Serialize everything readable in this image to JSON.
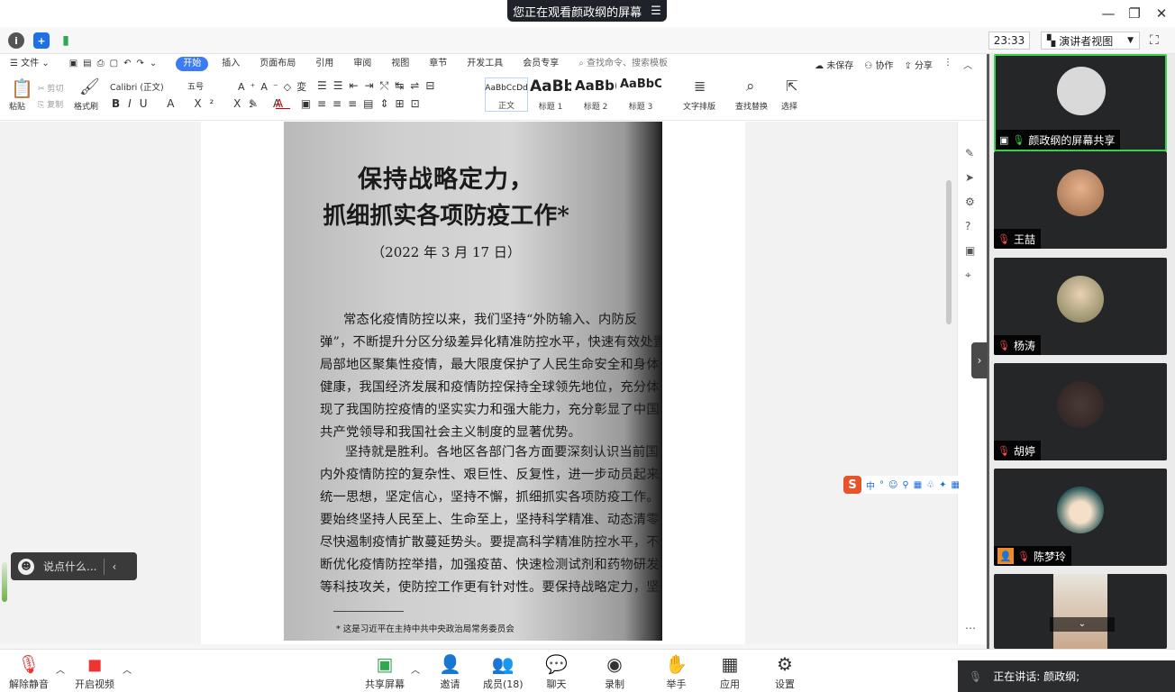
{
  "window": {
    "share_banner": "您正在观看颜政纲的屏幕",
    "min_icon": "—",
    "restore_icon": "❐",
    "close_icon": "✕"
  },
  "meeting_bar": {
    "clock": "23:33",
    "view_mode": "演讲者视图"
  },
  "wps": {
    "file_menu": "文件",
    "tabs": [
      "开始",
      "插入",
      "页面布局",
      "引用",
      "审阅",
      "视图",
      "章节",
      "开发工具",
      "会员专享"
    ],
    "search_placeholder": "查找命令、搜索模板",
    "right_actions": [
      "未保存",
      "协作",
      "分享"
    ],
    "clipboard": {
      "paste": "粘贴",
      "cut": "剪切",
      "copy": "复制",
      "format_painter": "格式刷"
    },
    "font_name": "Calibri (正文)",
    "font_size": "五号",
    "styles": [
      {
        "sample": "AaBbCcDd",
        "name": "正文"
      },
      {
        "sample": "AaBb",
        "name": "标题 1"
      },
      {
        "sample": "AaBb(",
        "name": "标题 2"
      },
      {
        "sample": "AaBbC",
        "name": "标题 3"
      }
    ],
    "text_layout": "文字排版",
    "find_replace": "查找替换",
    "select": "选择"
  },
  "document": {
    "title_line1": "保持战略定力，",
    "title_line2": "抓细抓实各项防疫工作*",
    "date": "（2022 年 3 月 17 日）",
    "lines": [
      "常态化疫情防控以来，我们坚持“外防输入、内防反",
      "弹”，不断提升分区分级差异化精准防控水平，快速有效处置",
      "局部地区聚集性疫情，最大限度保护了人民生命安全和身体",
      "健康，我国经济发展和疫情防控保持全球领先地位，充分体",
      "现了我国防控疫情的坚实实力和强大能力，充分彰显了中国",
      "共产党领导和我国社会主义制度的显著优势。",
      "坚持就是胜利。各地区各部门各方面要深刻认识当前国",
      "内外疫情防控的复杂性、艰巨性、反复性，进一步动员起来，",
      "统一思想，坚定信心，坚持不懈，抓细抓实各项防疫工作。",
      "要始终坚持人民至上、生命至上，坚持科学精准、动态清零，",
      "尽快遏制疫情扩散蔓延势头。要提高科学精准防控水平，不",
      "断优化疫情防控举措，加强疫苗、快速检测试剂和药物研发",
      "等科技攻关，使防控工作更有针对性。要保持战略定力，坚"
    ],
    "footnote": "* 这是习近平在主持中共中央政治局常务委员会"
  },
  "ime": {
    "logo": "S",
    "mode": "中"
  },
  "chat": {
    "placeholder": "说点什么..."
  },
  "participants": [
    {
      "name": "颜政纲的屏幕共享",
      "muted": false,
      "active": true,
      "sharing": true
    },
    {
      "name": "王喆",
      "muted": true,
      "active": false
    },
    {
      "name": "杨涛",
      "muted": true,
      "active": false
    },
    {
      "name": "胡婷",
      "muted": true,
      "active": false
    },
    {
      "name": "陈梦玲",
      "muted": true,
      "active": false
    },
    {
      "name": "",
      "muted": true,
      "active": false
    }
  ],
  "toolbar": {
    "unmute": "解除静音",
    "start_video": "开启视频",
    "share_screen": "共享屏幕",
    "invite": "邀请",
    "members": "成员(18)",
    "chat": "聊天",
    "record": "录制",
    "raise_hand": "举手",
    "apps": "应用",
    "settings": "设置"
  },
  "speaking": "正在讲话: 颜政纲;",
  "colors": {
    "accent": "#3b7cf5",
    "active_border": "#3ccf4e",
    "muted_red": "#ff4d4f",
    "share_green": "#2fa84f"
  }
}
